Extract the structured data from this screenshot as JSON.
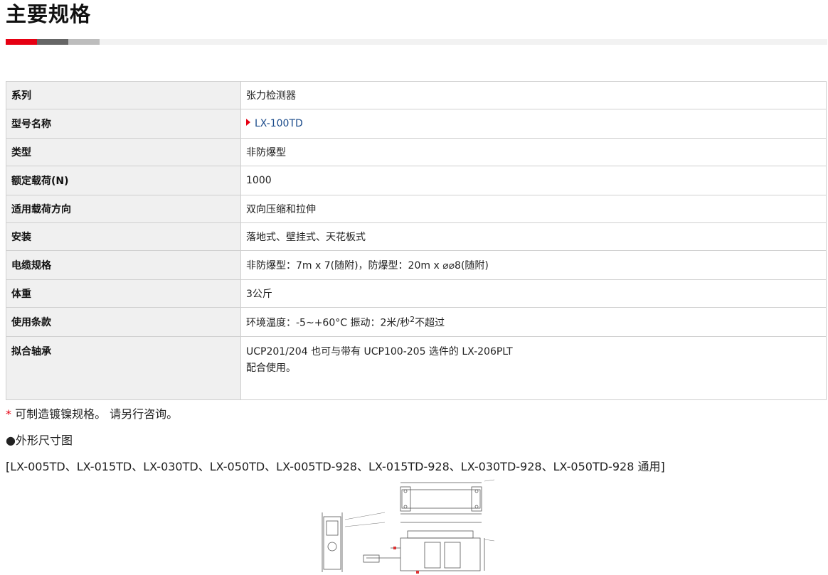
{
  "page": {
    "title": "主要规格"
  },
  "title_bar_colors": [
    "#e60012",
    "#666666",
    "#bdbdbd",
    "#f2f2f2"
  ],
  "spec_table": {
    "rows": [
      {
        "key": "系列",
        "value": "张力检测器"
      },
      {
        "key": "型号名称",
        "value": "LX-100TD",
        "link": true,
        "icon": "red-arrow-icon"
      },
      {
        "key": "类型",
        "value": "非防爆型"
      },
      {
        "key": "额定载荷(N)",
        "value": "1000"
      },
      {
        "key": "适用载荷方向",
        "value": "双向压缩和拉伸"
      },
      {
        "key": "安装",
        "value": "落地式、壁挂式、天花板式"
      },
      {
        "key": "电缆规格",
        "value": "非防爆型：7m x 7(随附)，防爆型：20m x ⌀⌀8(随附)"
      },
      {
        "key": "体重",
        "value": "3公斤"
      },
      {
        "key": "使用条款",
        "value_before": "环境温度：-5~+60°C 振动：2米/秒",
        "value_sup": "2",
        "value_after": "不超过"
      },
      {
        "key": "拟合轴承",
        "value_line1": "UCP201/204 也可与带有 UCP100-205 选件的 LX-206PLT",
        "value_line2": "配合使用。"
      }
    ]
  },
  "note": {
    "asterisk": "*",
    "text": "可制造镀镍规格。 请另行咨询。"
  },
  "dimensions": {
    "heading": "●外形尺寸图",
    "models": "[LX-005TD、LX-015TD、LX-030TD、LX-050TD、LX-005TD-928、LX-015TD-928、LX-030TD-928、LX-050TD-928 通用]"
  }
}
